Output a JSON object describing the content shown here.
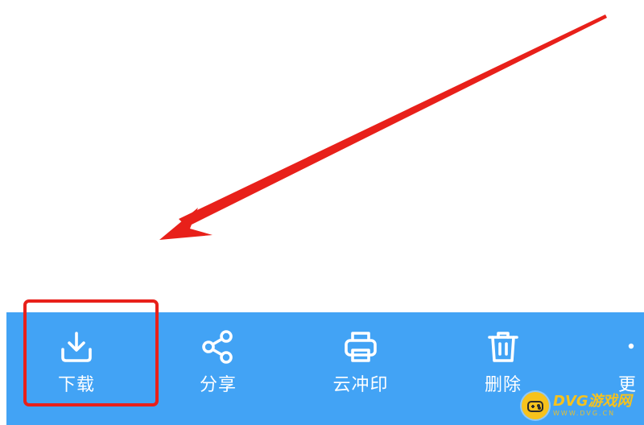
{
  "toolbar": {
    "items": [
      {
        "label": "下载",
        "icon": "download-icon"
      },
      {
        "label": "分享",
        "icon": "share-icon"
      },
      {
        "label": "云冲印",
        "icon": "printer-icon"
      },
      {
        "label": "删除",
        "icon": "trash-icon"
      },
      {
        "label": "更",
        "icon": "more-icon"
      }
    ]
  },
  "annotation": {
    "arrow_color": "#e8201a",
    "highlight_color": "#e8201a"
  },
  "watermark": {
    "title": "DVG游戏网",
    "subtitle": "WWW.DVG.CN"
  },
  "colors": {
    "toolbar_bg": "#42a3f5",
    "watermark": "#f6c21d"
  }
}
